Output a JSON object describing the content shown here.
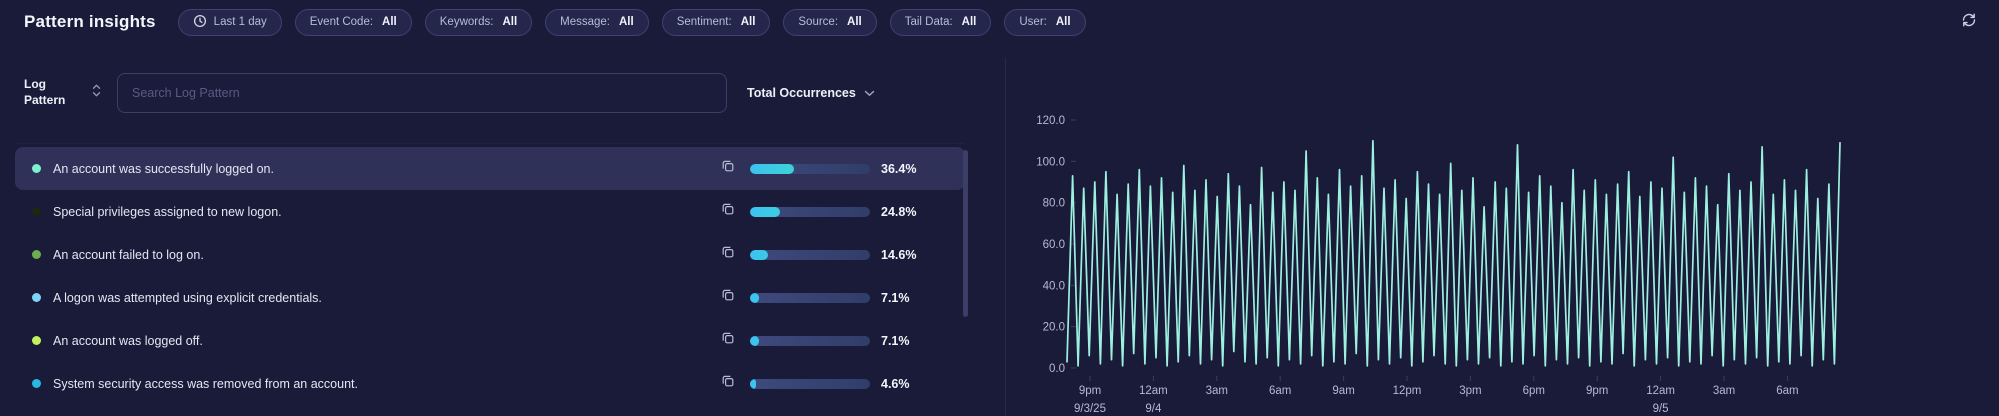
{
  "header": {
    "title": "Pattern insights",
    "time_filter": {
      "icon": "clock-icon",
      "label": "Last 1 day"
    },
    "filters": [
      {
        "label": "Event Code:",
        "value": "All"
      },
      {
        "label": "Keywords:",
        "value": "All"
      },
      {
        "label": "Message:",
        "value": "All"
      },
      {
        "label": "Sentiment:",
        "value": "All"
      },
      {
        "label": "Source:",
        "value": "All"
      },
      {
        "label": "Tail Data:",
        "value": "All"
      },
      {
        "label": "User:",
        "value": "All"
      }
    ],
    "refresh_icon": "refresh-icon"
  },
  "log_panel": {
    "column_header": "Log Pattern",
    "search_placeholder": "Search Log Pattern",
    "sort_header": "Total Occurrences",
    "rows": [
      {
        "text": "An account was successfully logged on.",
        "percent": "36.4%",
        "percent_value": 36.4,
        "dot_color": "#7ef0cf",
        "selected": true
      },
      {
        "text": "Special privileges assigned to new logon.",
        "percent": "24.8%",
        "percent_value": 24.8,
        "dot_color": "#1b2710",
        "selected": false
      },
      {
        "text": "An account failed to log on.",
        "percent": "14.6%",
        "percent_value": 14.6,
        "dot_color": "#6cae4e",
        "selected": false
      },
      {
        "text": "A logon was attempted using explicit credentials.",
        "percent": "7.1%",
        "percent_value": 7.1,
        "dot_color": "#7ed4f8",
        "selected": false
      },
      {
        "text": "An account was logged off.",
        "percent": "7.1%",
        "percent_value": 7.1,
        "dot_color": "#c3f25c",
        "selected": false
      },
      {
        "text": "System security access was removed from an account.",
        "percent": "4.6%",
        "percent_value": 4.6,
        "dot_color": "#28b8e0",
        "selected": false
      }
    ],
    "bar_colors": {
      "track": "#35406d",
      "fill_start": "#3cc3f0",
      "fill_end": "#40e9ae"
    }
  },
  "chart_data": {
    "type": "line",
    "title": "",
    "xlabel": "",
    "ylabel": "",
    "ylim": [
      0,
      120
    ],
    "grid": false,
    "legend": "none",
    "line_color": "#9df0e0",
    "axis_label_color": "#b6b9d2",
    "yticks": [
      "0.0",
      "20.0",
      "40.0",
      "60.0",
      "80.0",
      "100.0",
      "120.0"
    ],
    "xticks": [
      {
        "label": "9pm",
        "date": "9/3/25"
      },
      {
        "label": "12am",
        "date": "9/4"
      },
      {
        "label": "3am",
        "date": ""
      },
      {
        "label": "6am",
        "date": ""
      },
      {
        "label": "9am",
        "date": ""
      },
      {
        "label": "12pm",
        "date": ""
      },
      {
        "label": "3pm",
        "date": ""
      },
      {
        "label": "6pm",
        "date": ""
      },
      {
        "label": "9pm",
        "date": ""
      },
      {
        "label": "12am",
        "date": "9/5"
      },
      {
        "label": "3am",
        "date": ""
      },
      {
        "label": "6am",
        "date": ""
      }
    ],
    "values": [
      3,
      93,
      1,
      87,
      6,
      90,
      2,
      95,
      4,
      84,
      1,
      89,
      7,
      96,
      2,
      88,
      5,
      92,
      1,
      85,
      3,
      98,
      6,
      86,
      2,
      91,
      4,
      83,
      1,
      94,
      8,
      88,
      3,
      79,
      2,
      97,
      5,
      85,
      1,
      90,
      4,
      86,
      2,
      105,
      6,
      92,
      1,
      84,
      3,
      96,
      2,
      88,
      7,
      93,
      1,
      110,
      4,
      87,
      2,
      91,
      5,
      82,
      1,
      95,
      3,
      89,
      6,
      84,
      2,
      99,
      1,
      86,
      4,
      92,
      2,
      78,
      5,
      90,
      1,
      87,
      3,
      108,
      2,
      85,
      6,
      93,
      1,
      88,
      4,
      80,
      2,
      96,
      5,
      86,
      1,
      91,
      3,
      84,
      2,
      89,
      7,
      95,
      1,
      83,
      4,
      90,
      2,
      87,
      5,
      102,
      1,
      85,
      3,
      92,
      2,
      88,
      6,
      79,
      1,
      94,
      4,
      86,
      2,
      90,
      5,
      107,
      1,
      84,
      3,
      91,
      2,
      86,
      6,
      96,
      1,
      82,
      4,
      89,
      2,
      109
    ]
  }
}
